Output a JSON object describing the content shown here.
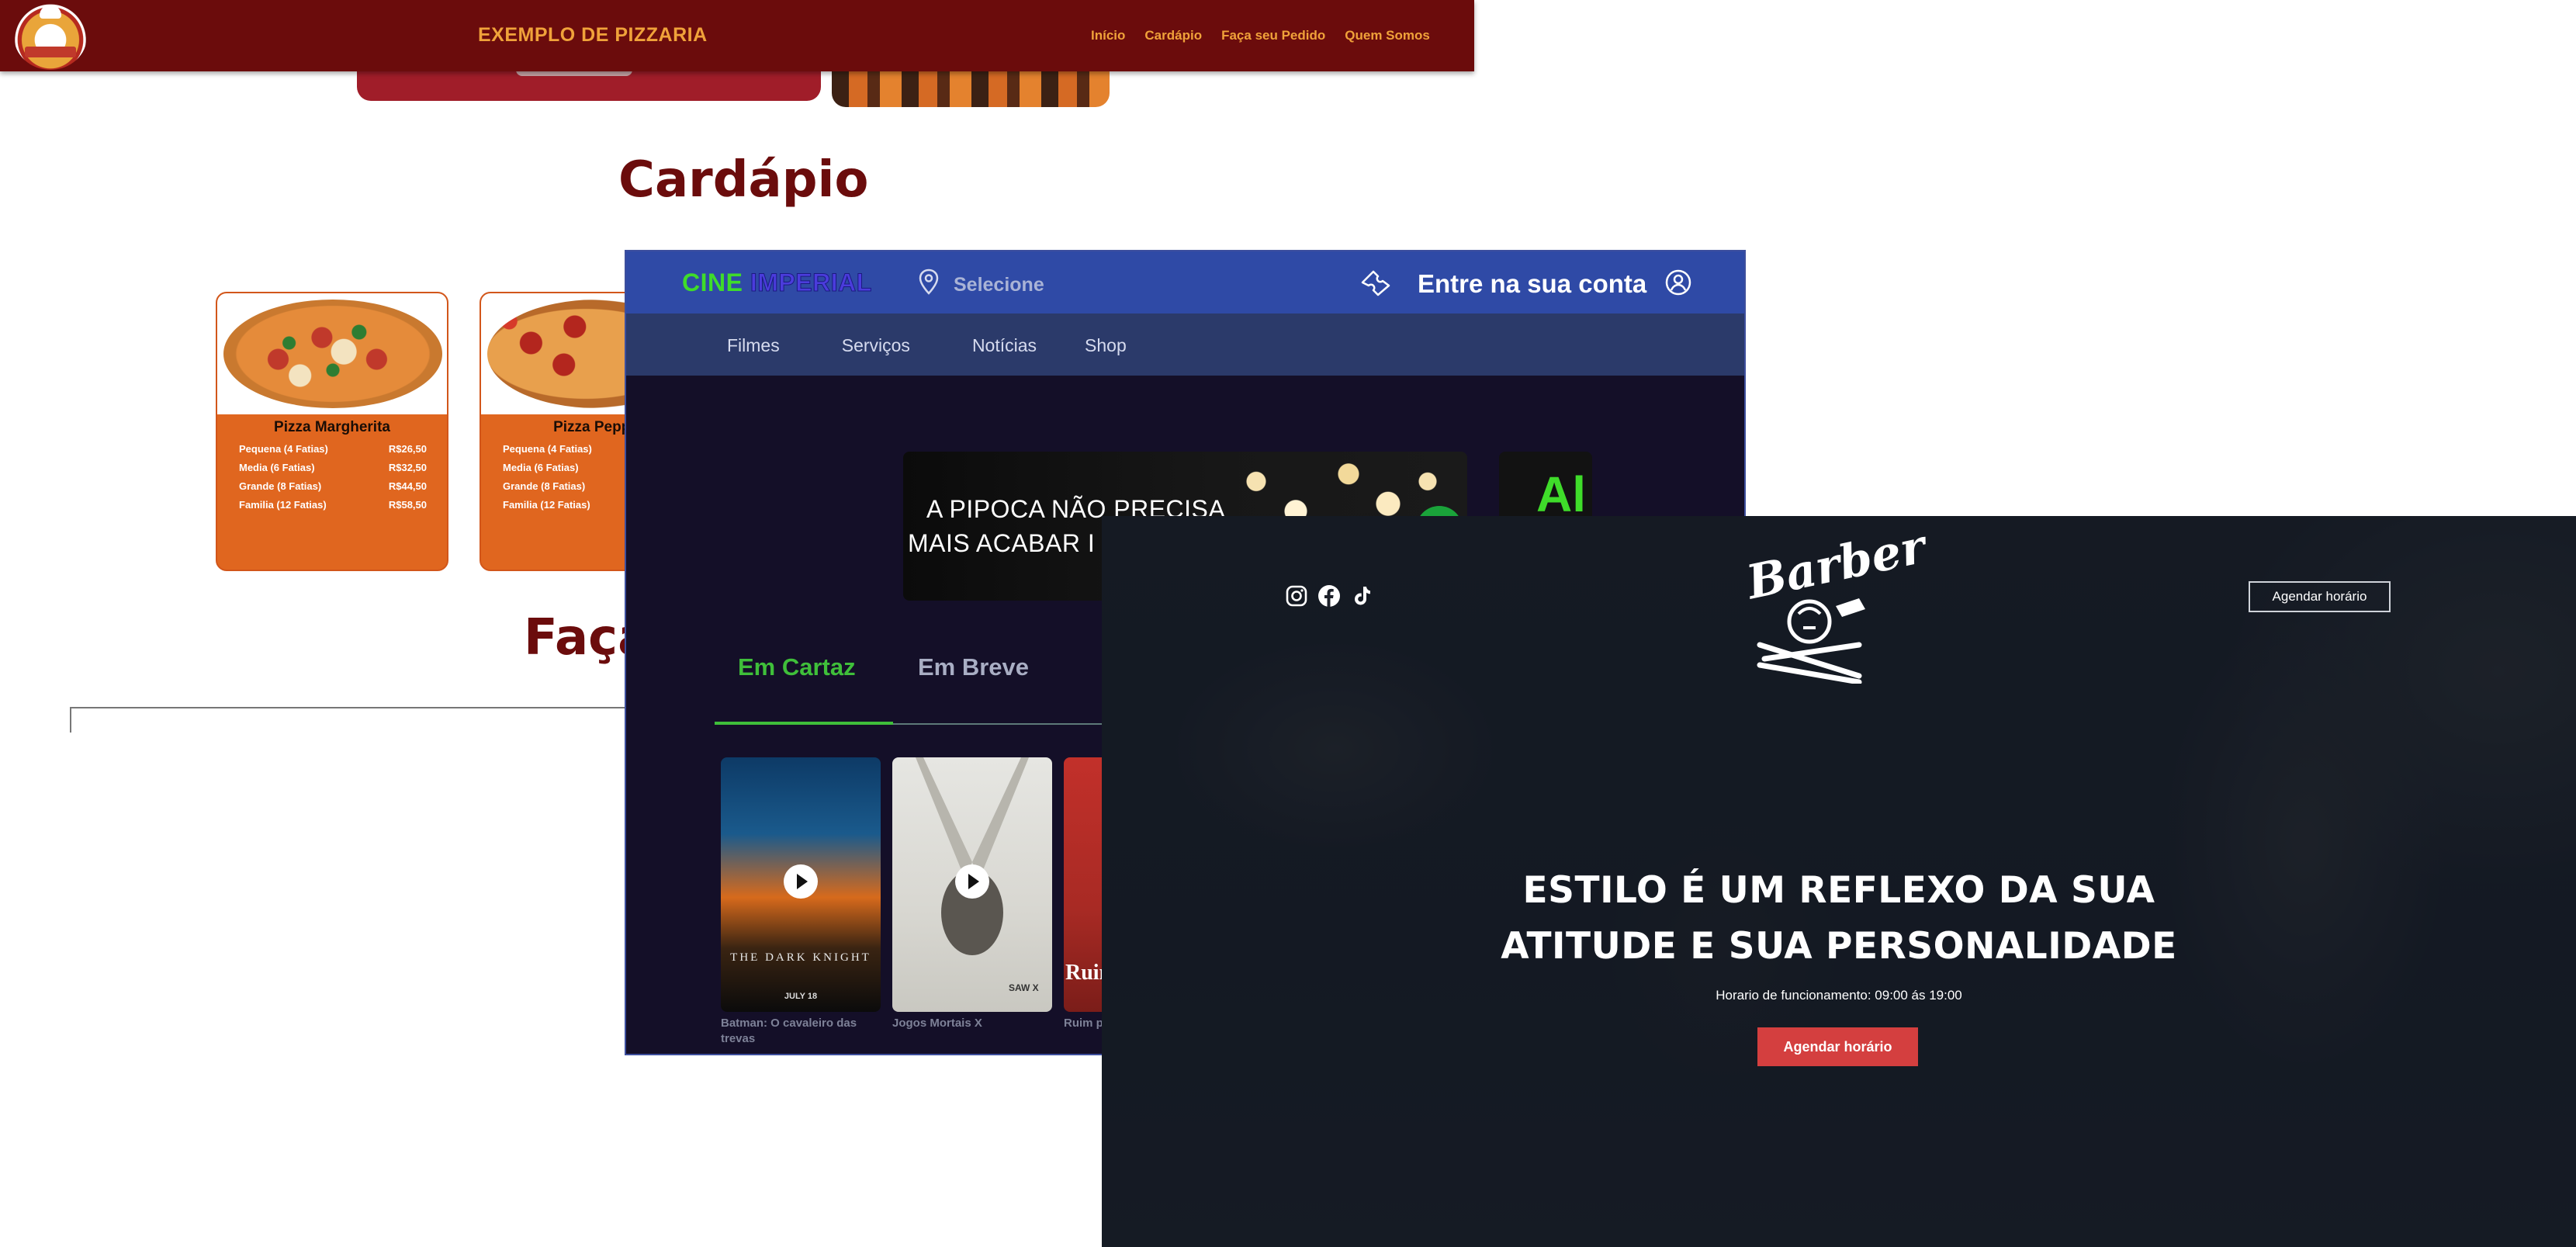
{
  "pizzaria": {
    "brand": "EXEMPLO DE PIZZARIA",
    "nav": [
      "Início",
      "Cardápio",
      "Faça seu Pedido",
      "Quem Somos"
    ],
    "section_menu": "Cardápio",
    "section_order": "Faça",
    "products": [
      {
        "name": "Pizza Margherita",
        "sizes": [
          {
            "label": "Pequena (4 Fatias)",
            "price": "R$26,50"
          },
          {
            "label": "Media (6 Fatias)",
            "price": "R$32,50"
          },
          {
            "label": "Grande (8 Fatias)",
            "price": "R$44,50"
          },
          {
            "label": "Familia (12 Fatias)",
            "price": "R$58,50"
          }
        ]
      },
      {
        "name": "Pizza Peppe",
        "sizes": [
          {
            "label": "Pequena (4 Fatias)",
            "price": ""
          },
          {
            "label": "Media (6 Fatias)",
            "price": ""
          },
          {
            "label": "Grande (8 Fatias)",
            "price": ""
          },
          {
            "label": "Familia (12 Fatias)",
            "price": ""
          }
        ]
      }
    ]
  },
  "cine": {
    "logo_part1": "CINE",
    "logo_part2": "IMPERIAL",
    "location_placeholder": "Selecione",
    "login": "Entre na sua conta",
    "nav": [
      "Filmes",
      "Serviços",
      "Notícias",
      "Shop"
    ],
    "banner_line1": "A PIPOCA NÃO PRECISA",
    "banner_line2": "MAIS ACABAR I",
    "banner2_text": "Al",
    "tabs": [
      "Em Cartaz",
      "Em Breve"
    ],
    "movies": [
      {
        "title": "Batman: O cavaleiro das trevas",
        "poster_text": "THE DARK KNIGHT",
        "poster_date": "JULY 18"
      },
      {
        "title": "Jogos Mortais X",
        "poster_text": "SAW X"
      },
      {
        "title": "Ruim p",
        "poster_text": "Ruin"
      }
    ]
  },
  "barber": {
    "logo": "Barber",
    "social_icons": [
      "instagram-icon",
      "facebook-icon",
      "tiktok-icon"
    ],
    "book_top": "Agendar horário",
    "headline_line1": "ESTILO É UM REFLEXO DA SUA",
    "headline_line2": "ATITUDE E SUA PERSONALIDADE",
    "hours": "Horario de funcionamento: 09:00 ás 19:00",
    "book_main": "Agendar horário",
    "accent": "#d43f3f"
  }
}
